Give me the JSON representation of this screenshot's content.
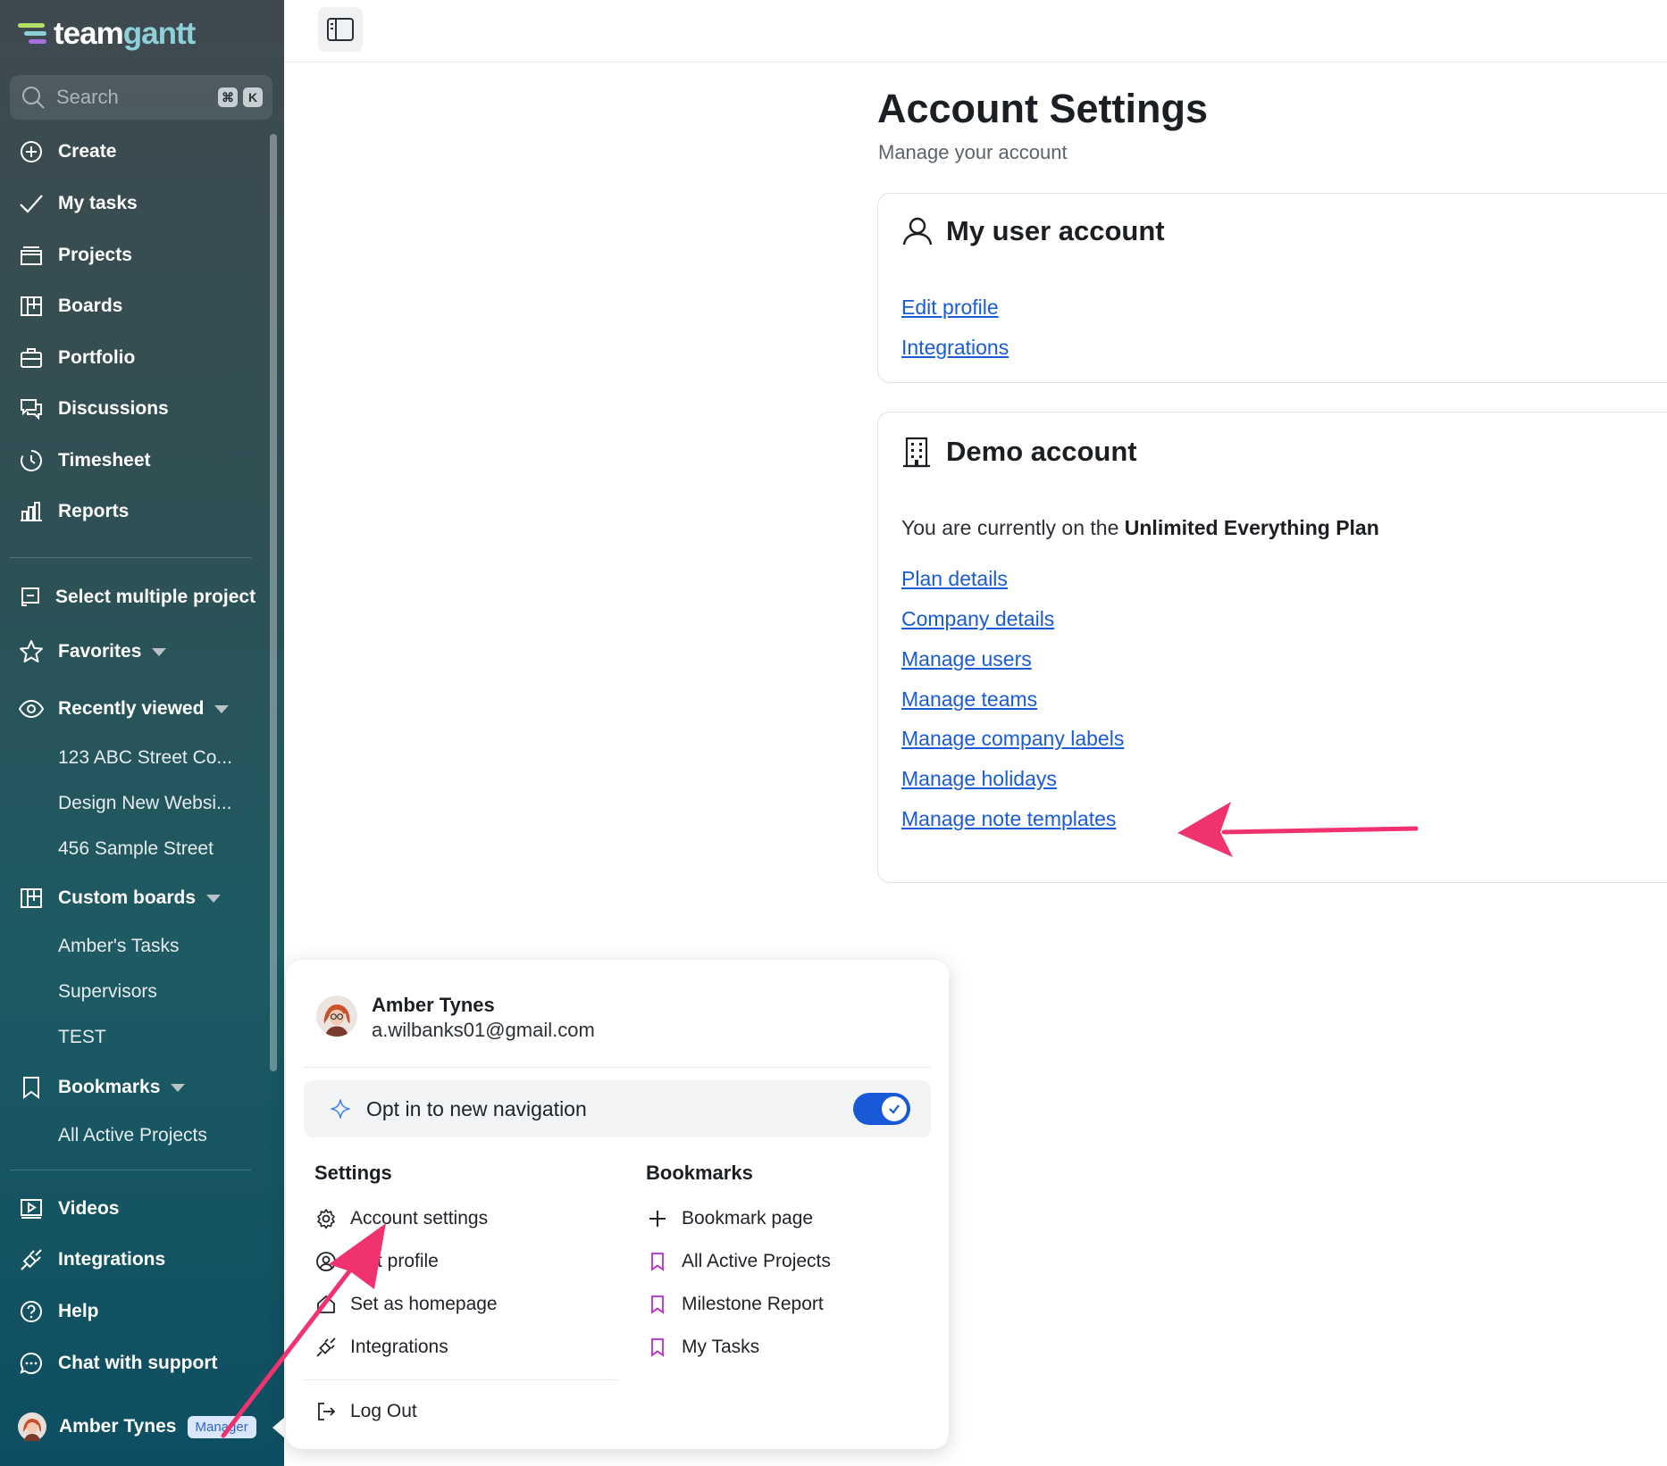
{
  "brand": {
    "logo_part1": "team",
    "logo_part2": "gantt"
  },
  "sidebar": {
    "search_placeholder": "Search",
    "shortcut_keys": [
      "⌘",
      "K"
    ],
    "main_nav": [
      {
        "label": "Create",
        "icon": "plus-circle-icon"
      },
      {
        "label": "My tasks",
        "icon": "check-icon"
      },
      {
        "label": "Projects",
        "icon": "projects-icon"
      },
      {
        "label": "Boards",
        "icon": "boards-icon"
      },
      {
        "label": "Portfolio",
        "icon": "briefcase-icon"
      },
      {
        "label": "Discussions",
        "icon": "chat-bubbles-icon"
      },
      {
        "label": "Timesheet",
        "icon": "clock-icon"
      },
      {
        "label": "Reports",
        "icon": "bar-chart-icon"
      }
    ],
    "select_multiple": "Select multiple project",
    "favorites": "Favorites",
    "recently_viewed": "Recently viewed",
    "recent_items": [
      "123 ABC Street Co...",
      "Design New Websi...",
      "456 Sample Street"
    ],
    "custom_boards": "Custom boards",
    "board_items": [
      "Amber's Tasks",
      "Supervisors",
      "TEST"
    ],
    "bookmarks": "Bookmarks",
    "bookmark_items": [
      "All Active Projects"
    ],
    "bottom_nav": [
      {
        "label": "Videos",
        "icon": "video-icon"
      },
      {
        "label": "Integrations",
        "icon": "plug-icon"
      },
      {
        "label": "Help",
        "icon": "help-icon"
      },
      {
        "label": "Chat with support",
        "icon": "chat-support-icon"
      }
    ],
    "user_name": "Amber Tynes",
    "user_role": "Manager"
  },
  "main": {
    "title": "Account Settings",
    "subtitle": "Manage your account",
    "user_card": {
      "title": "My user account",
      "links": [
        "Edit profile",
        "Integrations"
      ]
    },
    "demo_card": {
      "title": "Demo account",
      "plan_prefix": "You are currently on the",
      "plan_name": "Unlimited Everything Plan",
      "links": [
        "Plan details",
        "Company details",
        "Manage users",
        "Manage teams",
        "Manage company labels",
        "Manage holidays",
        "Manage note templates"
      ]
    }
  },
  "popup": {
    "user_name": "Amber Tynes",
    "user_email": "a.wilbanks01@gmail.com",
    "opt_in_label": "Opt in to new navigation",
    "opt_in_enabled": true,
    "settings_title": "Settings",
    "settings_items": [
      {
        "label": "Account settings",
        "icon": "gear-icon"
      },
      {
        "label": "t profile",
        "icon": "user-gear-icon"
      },
      {
        "label": "Set as homepage",
        "icon": "home-icon"
      },
      {
        "label": "Integrations",
        "icon": "plug-icon"
      }
    ],
    "bookmarks_title": "Bookmarks",
    "bookmark_items": [
      {
        "label": "Bookmark page",
        "icon": "plus-icon"
      },
      {
        "label": "All Active Projects",
        "icon": "bookmark-icon"
      },
      {
        "label": "Milestone Report",
        "icon": "bookmark-icon"
      },
      {
        "label": "My Tasks",
        "icon": "bookmark-icon"
      }
    ],
    "logout_label": "Log Out"
  },
  "colors": {
    "link": "#1a5bd6",
    "toggle": "#1759d6",
    "annotation_arrow": "#f0336f",
    "bookmark_icon": "#c026d3"
  }
}
